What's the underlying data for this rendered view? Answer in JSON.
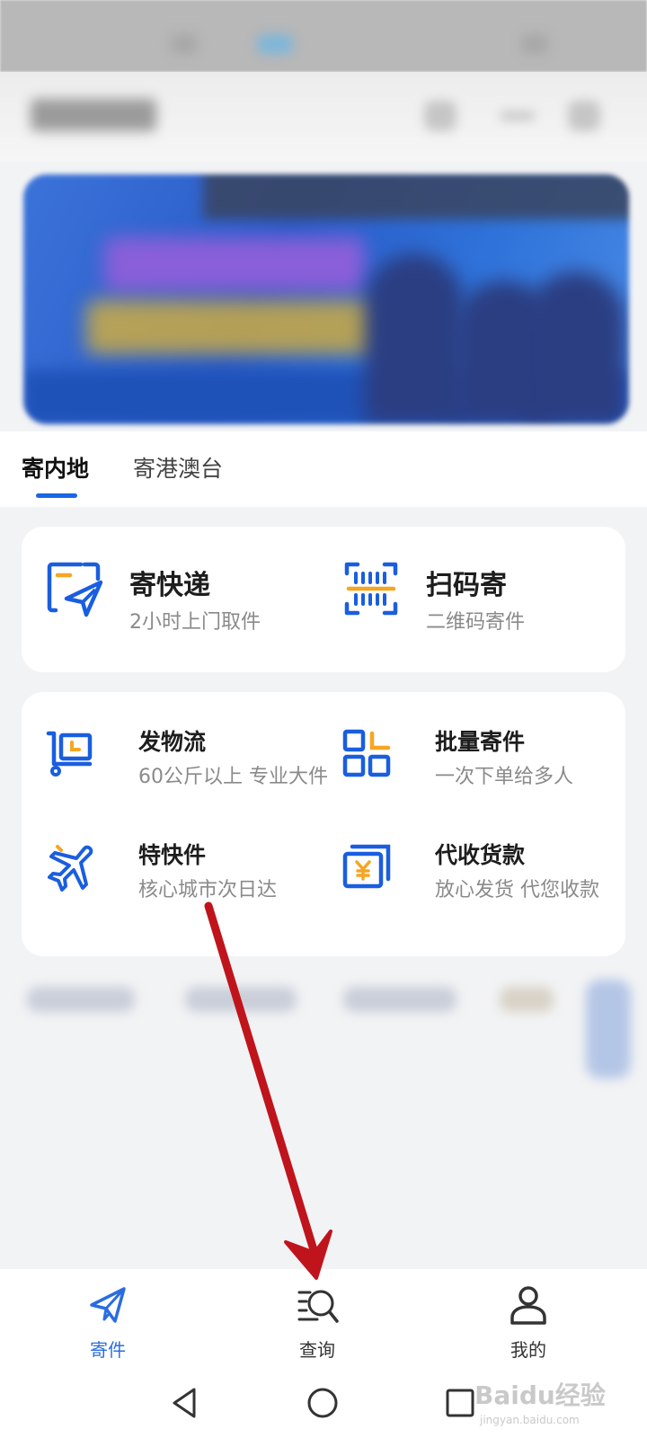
{
  "tabs": [
    {
      "label": "寄内地",
      "active": true
    },
    {
      "label": "寄港澳台",
      "active": false
    }
  ],
  "quick_actions": [
    {
      "title": "寄快递",
      "subtitle": "2小时上门取件",
      "icon": "paper-plane-box-icon"
    },
    {
      "title": "扫码寄",
      "subtitle": "二维码寄件",
      "icon": "barcode-scan-icon"
    }
  ],
  "services": [
    {
      "title": "发物流",
      "subtitle": "60公斤以上 专业大件",
      "icon": "cart-box-icon"
    },
    {
      "title": "批量寄件",
      "subtitle": "一次下单给多人",
      "icon": "grid-boxes-icon"
    },
    {
      "title": "特快件",
      "subtitle": "核心城市次日达",
      "icon": "airplane-icon"
    },
    {
      "title": "代收货款",
      "subtitle": "放心发货 代您收款",
      "icon": "yuan-card-icon"
    }
  ],
  "bottom_nav": [
    {
      "label": "寄件",
      "icon": "send-icon",
      "active": true
    },
    {
      "label": "查询",
      "icon": "search-list-icon",
      "active": false
    },
    {
      "label": "我的",
      "icon": "person-icon",
      "active": false
    }
  ],
  "system_nav": [
    "back-icon",
    "home-icon",
    "recents-icon"
  ],
  "watermark": {
    "brand": "Baidu经验",
    "site": "jingyan.baidu.com"
  },
  "colors": {
    "accent": "#2a6de0",
    "icon_blue": "#1a5ee0",
    "icon_orange": "#f5a623",
    "annotation": "#c0141c"
  }
}
